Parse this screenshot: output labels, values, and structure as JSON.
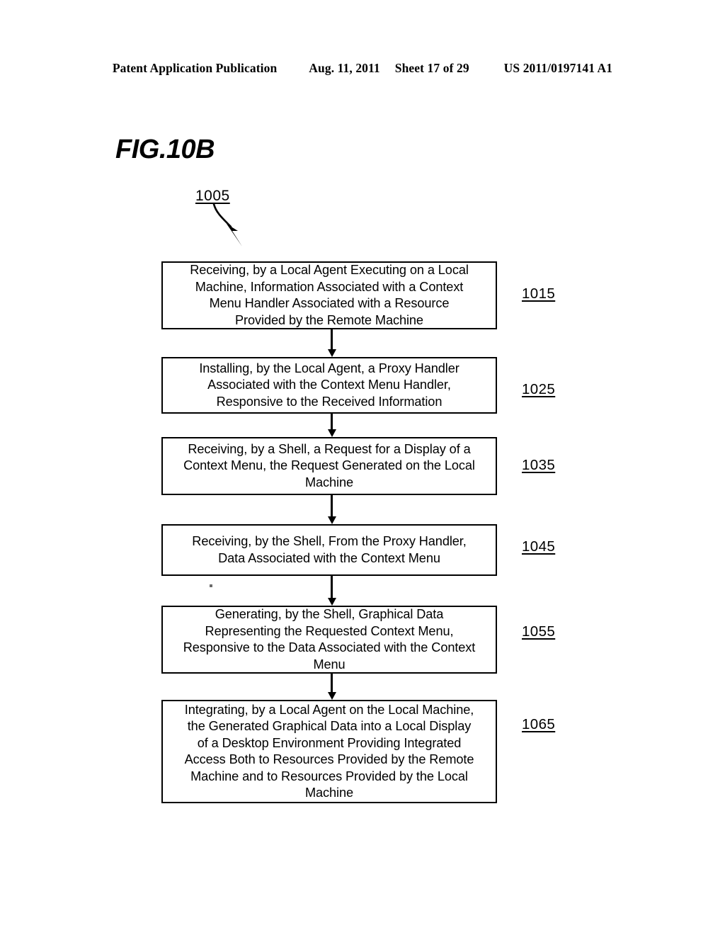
{
  "header": {
    "publication": "Patent Application Publication",
    "date": "Aug. 11, 2011",
    "sheet": "Sheet 17 of 29",
    "patent_number": "US 2011/0197141 A1"
  },
  "figure": {
    "title": "FIG.10B",
    "flow_reference": "1005"
  },
  "flowchart": {
    "type": "flowchart",
    "orientation": "vertical",
    "steps": [
      {
        "ref": "1015",
        "text": "Receiving, by a Local Agent Executing on a Local\nMachine, Information Associated with a Context\nMenu Handler Associated with a Resource\nProvided by the Remote Machine"
      },
      {
        "ref": "1025",
        "text": "Installing, by the Local Agent, a Proxy Handler\nAssociated with the Context Menu Handler,\nResponsive to the Received Information"
      },
      {
        "ref": "1035",
        "text": "Receiving, by a Shell, a Request for a Display of a\nContext Menu, the Request Generated on the Local\nMachine"
      },
      {
        "ref": "1045",
        "text": "Receiving, by the Shell, From the Proxy Handler,\nData Associated with the Context Menu"
      },
      {
        "ref": "1055",
        "text": "Generating, by the Shell, Graphical Data\nRepresenting the Requested Context Menu,\nResponsive to the Data Associated with the Context\nMenu"
      },
      {
        "ref": "1065",
        "text": "Integrating, by a Local Agent on the Local Machine,\nthe Generated Graphical Data into a Local Display\nof a Desktop Environment Providing Integrated\nAccess Both to Resources Provided by the Remote\nMachine and to Resources Provided by the Local\nMachine"
      }
    ]
  }
}
